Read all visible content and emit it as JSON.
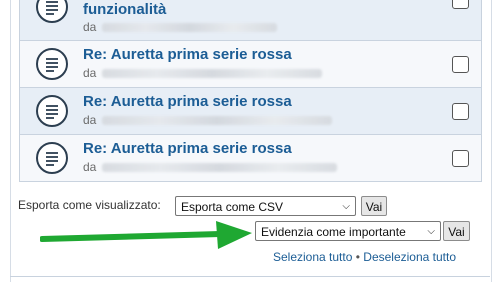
{
  "messages": [
    {
      "title": "funzionalità",
      "from_prefix": "da"
    },
    {
      "title": "Re: Auretta prima serie rossa",
      "from_prefix": "da"
    },
    {
      "title": "Re: Auretta prima serie rossa",
      "from_prefix": "da"
    },
    {
      "title": "Re: Auretta prima serie rossa",
      "from_prefix": "da"
    }
  ],
  "export": {
    "label": "Esporta come visualizzato:",
    "selected": "Esporta come CSV",
    "go_label": "Vai"
  },
  "mark": {
    "selected": "Evidenzia come importante",
    "go_label": "Vai"
  },
  "selection": {
    "select_all": "Seleziona tutto",
    "separator": "•",
    "deselect_all": "Deseleziona tutto"
  },
  "annotation": {
    "arrow_color": "#1fa832"
  },
  "colors": {
    "title": "#1c5d95",
    "row_alt": "#e7eef6"
  }
}
